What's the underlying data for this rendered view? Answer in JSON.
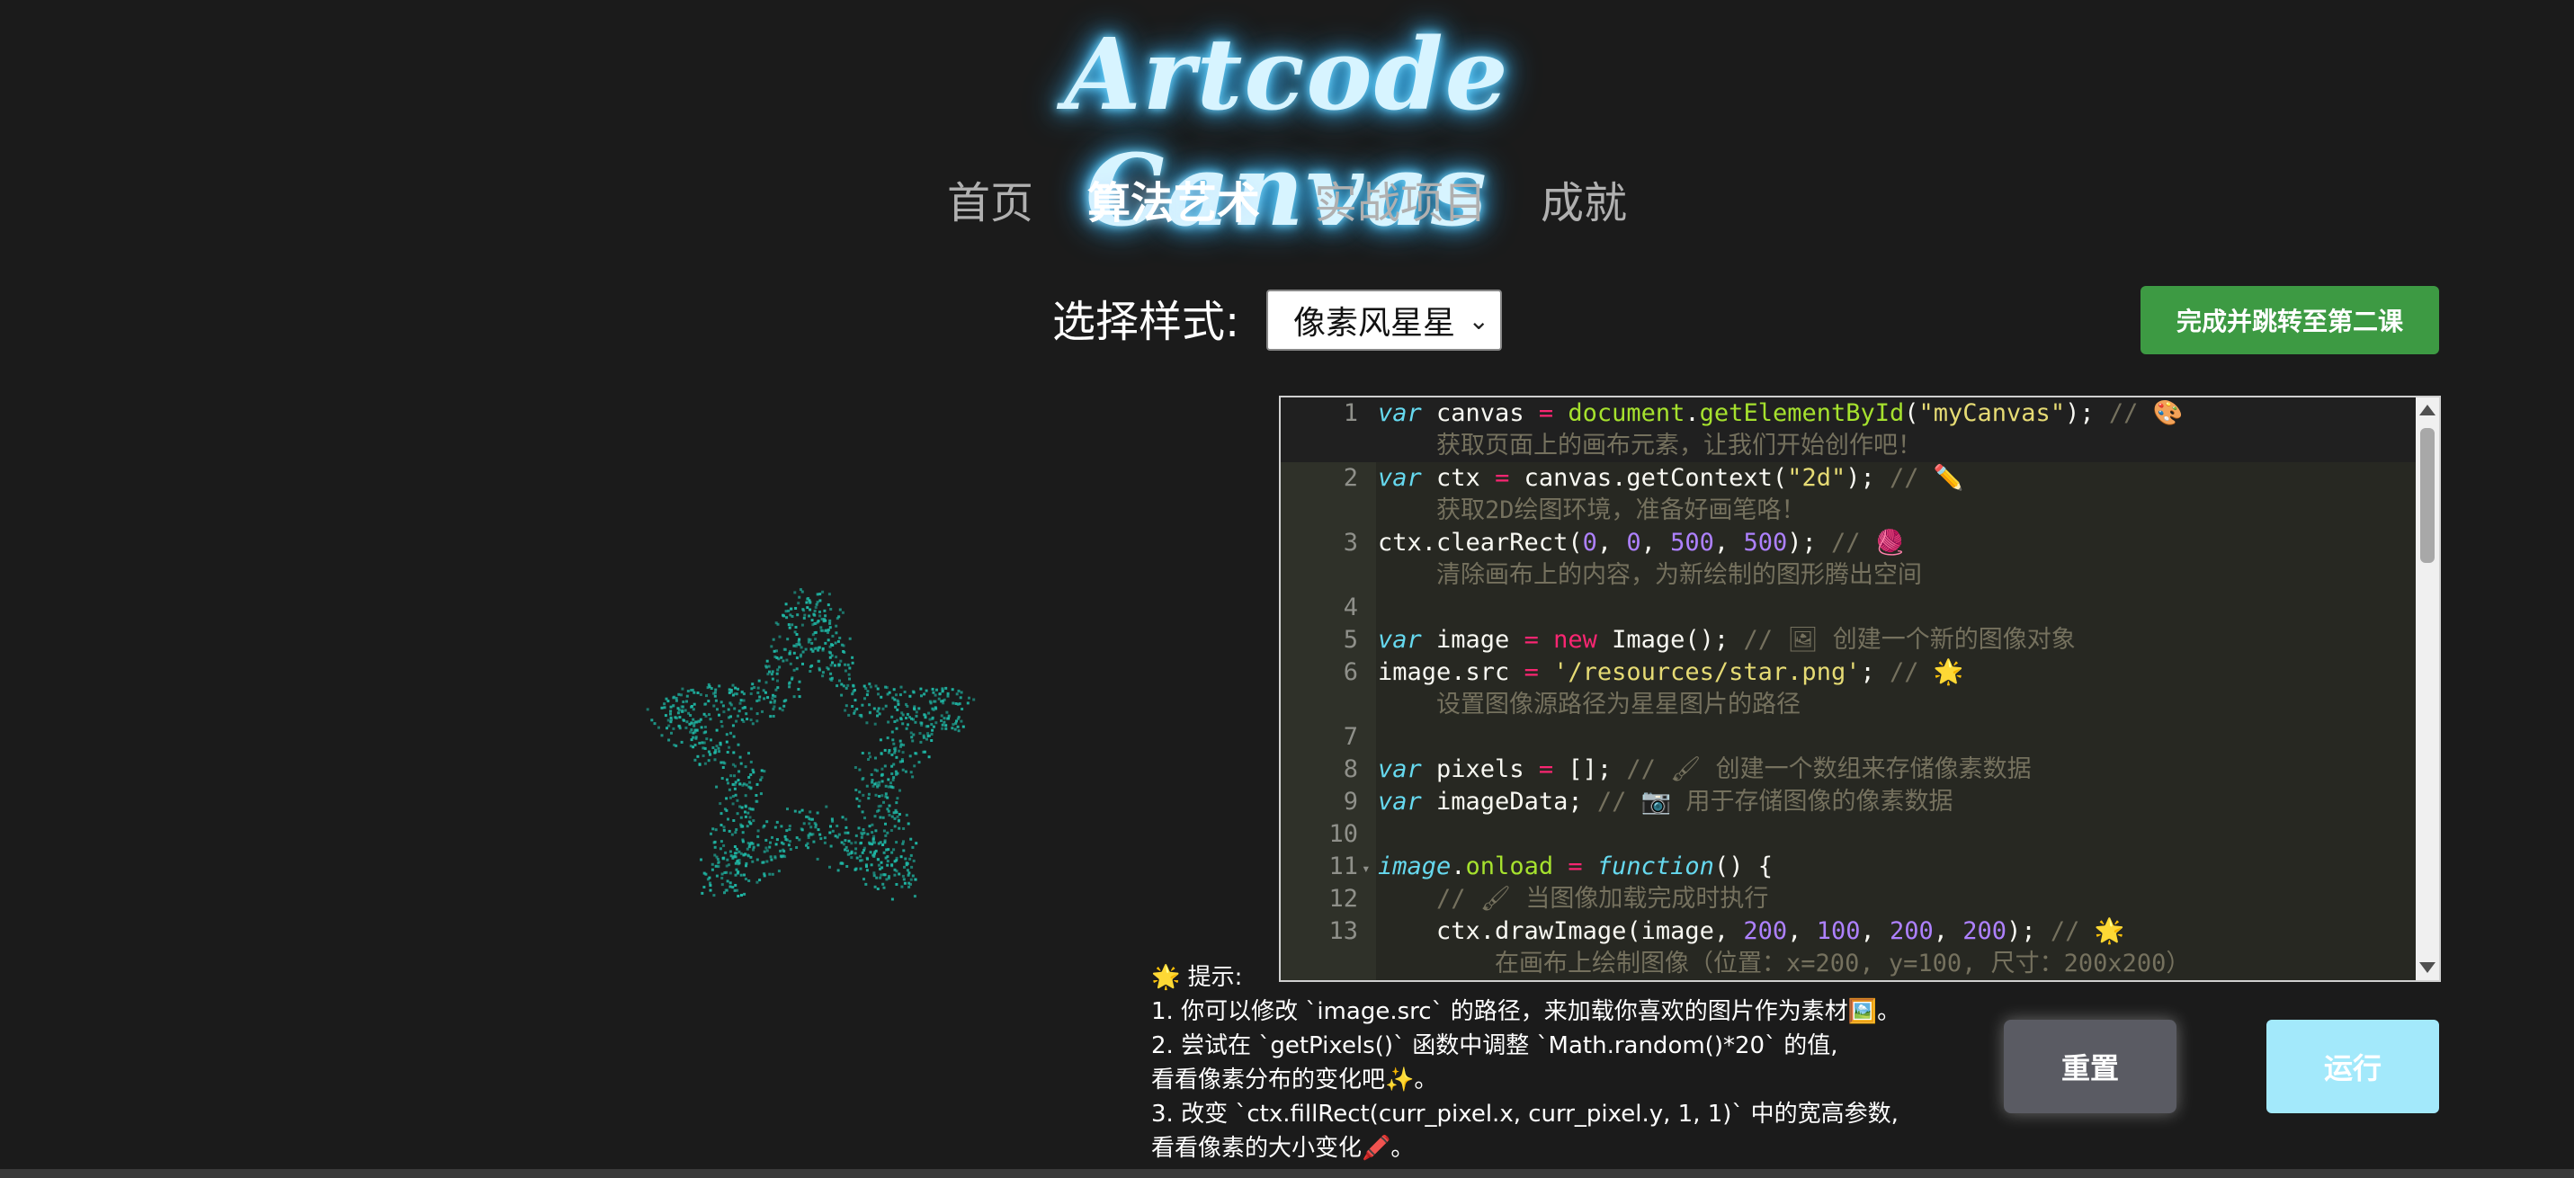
{
  "app": {
    "title": "Artcode Canvas"
  },
  "nav": {
    "items": [
      {
        "label": "首页"
      },
      {
        "label": "算法艺术"
      },
      {
        "label": "实战项目"
      },
      {
        "label": "成就"
      }
    ]
  },
  "style_selector": {
    "label": "选择样式:",
    "selected": "像素风星星"
  },
  "buttons": {
    "next": "完成并跳转至第二课",
    "reset": "重置",
    "run": "运行"
  },
  "colors": {
    "star": "#1fb7a5",
    "next_button": "#3d9a43",
    "run_button": "#a3e9fb",
    "reset_button": "#5a5b63"
  },
  "editor": {
    "line_numbers": [
      "1",
      "2",
      "3",
      "4",
      "5",
      "6",
      "7",
      "8",
      "9",
      "10",
      "11",
      "12",
      "13"
    ],
    "lines": {
      "l1a": "获取页面上的画布元素，让我们开始创作吧！",
      "l2a": "获取2D绘图环境，准备好画笔咯！",
      "l3a": "清除画布上的内容，为新绘制的图形腾出空间",
      "l5c": "// 🖼 创建一个新的图像对象",
      "l6str": "'/resources/star.png'",
      "l6a": "设置图像源路径为星星图片的路径",
      "l8c": "// 🖌 创建一个数组来存储像素数据",
      "l9c": "// 📷 用于存储图像的像素数据",
      "l12c": "// 🖌 当图像加载完成时执行",
      "l13a": "在画布上绘制图像（位置：x=200, y=100, 尺寸：200x200）"
    }
  },
  "tips": {
    "header": "🌟 提示:",
    "items": [
      "1. 你可以修改 `image.src` 的路径，来加载你喜欢的图片作为素材🖼️。",
      "2. 尝试在 `getPixels()` 函数中调整 `Math.random()*20` 的值,",
      "看看像素分布的变化吧✨。",
      "3. 改变 `ctx.fillRect(curr_pixel.x, curr_pixel.y, 1, 1)` 中的宽高参数,",
      "看看像素的大小变化🖍️。"
    ]
  }
}
